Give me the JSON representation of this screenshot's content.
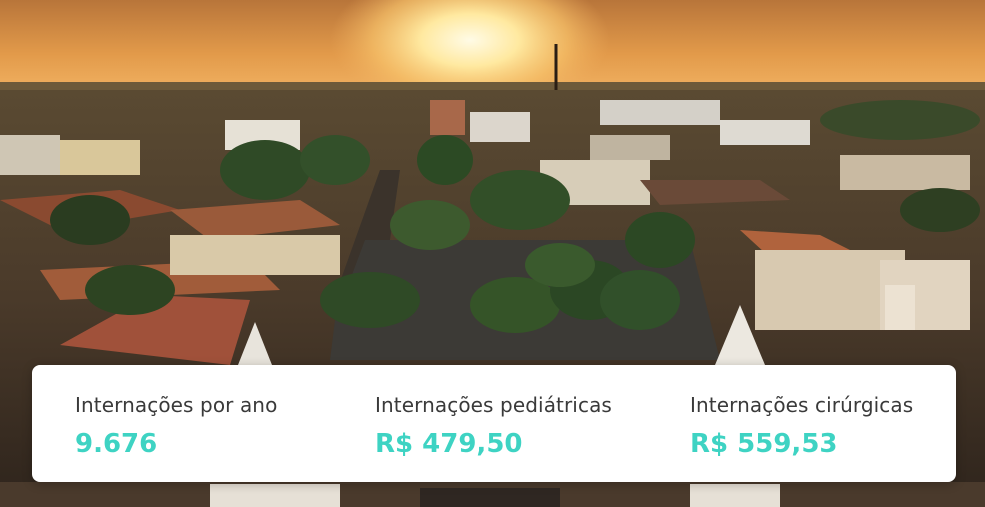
{
  "stats": [
    {
      "label": "Internações por ano",
      "value": "9.676"
    },
    {
      "label": "Internações pediátricas",
      "value": "R$ 479,50"
    },
    {
      "label": "Internações cirúrgicas",
      "value": "R$ 559,53"
    }
  ],
  "colors": {
    "value_accent": "#3ed3c3",
    "label_text": "#3a3a3a",
    "card_bg": "#ffffff"
  }
}
